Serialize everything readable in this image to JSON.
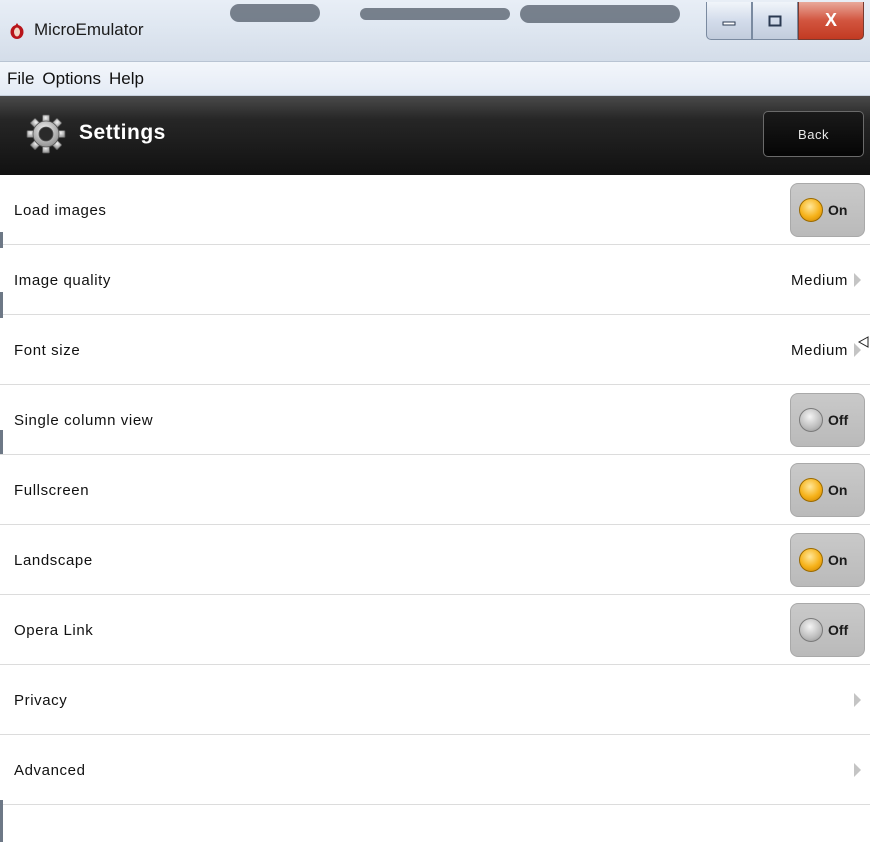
{
  "window": {
    "title": "MicroEmulator",
    "icons": {
      "app": "opera-o-icon",
      "minimize": "minimize-icon",
      "maximize": "maximize-icon",
      "close": "close-icon"
    },
    "close_glyph": "X"
  },
  "menu": {
    "items": [
      "File",
      "Options",
      "Help"
    ]
  },
  "header": {
    "title": "Settings",
    "icon": "gear-icon",
    "back_label": "Back",
    "colors": {
      "bar": "#1a1a1a",
      "title": "#ffffff"
    }
  },
  "settings": {
    "rows": [
      {
        "label": "Load images",
        "type": "toggle",
        "state": "On"
      },
      {
        "label": "Image quality",
        "type": "value",
        "value": "Medium"
      },
      {
        "label": "Font size",
        "type": "value",
        "value": "Medium"
      },
      {
        "label": "Single column view",
        "type": "toggle",
        "state": "Off"
      },
      {
        "label": "Fullscreen",
        "type": "toggle",
        "state": "On"
      },
      {
        "label": "Landscape",
        "type": "toggle",
        "state": "On"
      },
      {
        "label": "Opera Link",
        "type": "toggle",
        "state": "Off"
      },
      {
        "label": "Privacy",
        "type": "nav"
      },
      {
        "label": "Advanced",
        "type": "nav"
      }
    ],
    "colors": {
      "on_knob": "#f6b21a",
      "off_knob": "#bdbdbd",
      "toggle_bg": "#c4c4c4"
    }
  }
}
